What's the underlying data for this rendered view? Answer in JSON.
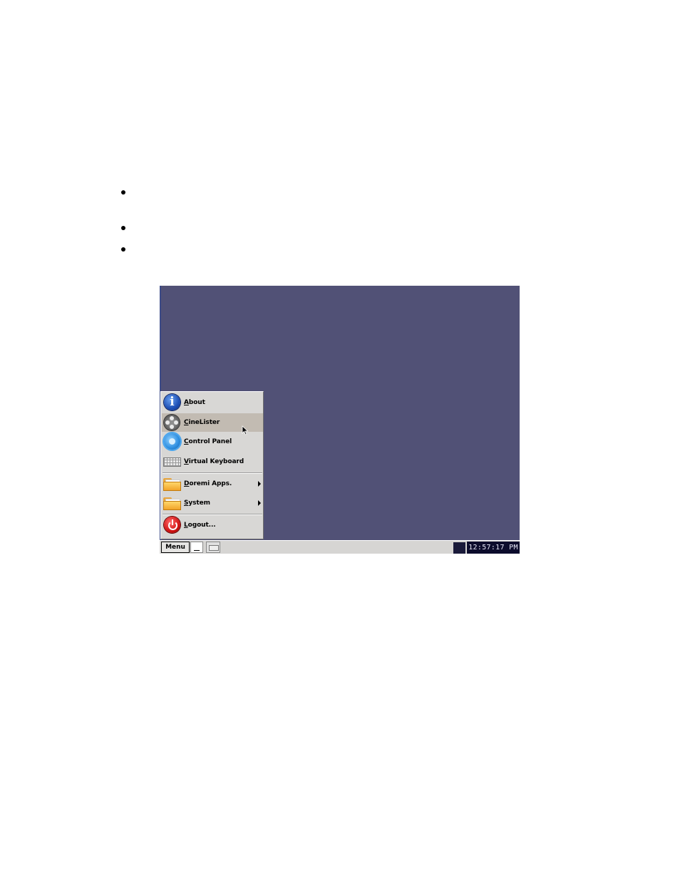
{
  "desktop": {
    "background_color": "#515176"
  },
  "start_menu": {
    "items": [
      {
        "label": "About",
        "icon": "info-icon",
        "highlighted": false,
        "submenu": false
      },
      {
        "label": "CineLister",
        "icon": "film-reel-icon",
        "highlighted": true,
        "submenu": false
      },
      {
        "label": "Control Panel",
        "icon": "gear-icon",
        "highlighted": false,
        "submenu": false
      },
      {
        "label": "Virtual Keyboard",
        "icon": "keyboard-icon",
        "highlighted": false,
        "submenu": false
      },
      {
        "label": "Doremi Apps.",
        "icon": "folder-icon",
        "highlighted": false,
        "submenu": true
      },
      {
        "label": "System",
        "icon": "folder-icon",
        "highlighted": false,
        "submenu": true
      },
      {
        "label": "Logout...",
        "icon": "power-icon",
        "highlighted": false,
        "submenu": false
      }
    ]
  },
  "taskbar": {
    "menu_label": "Menu",
    "clock": "12:57:17 PM"
  },
  "colors": {
    "highlight": "#c2bbb2",
    "menu_bg": "#d8d7d5",
    "clock_bg": "#0c0c2c"
  }
}
